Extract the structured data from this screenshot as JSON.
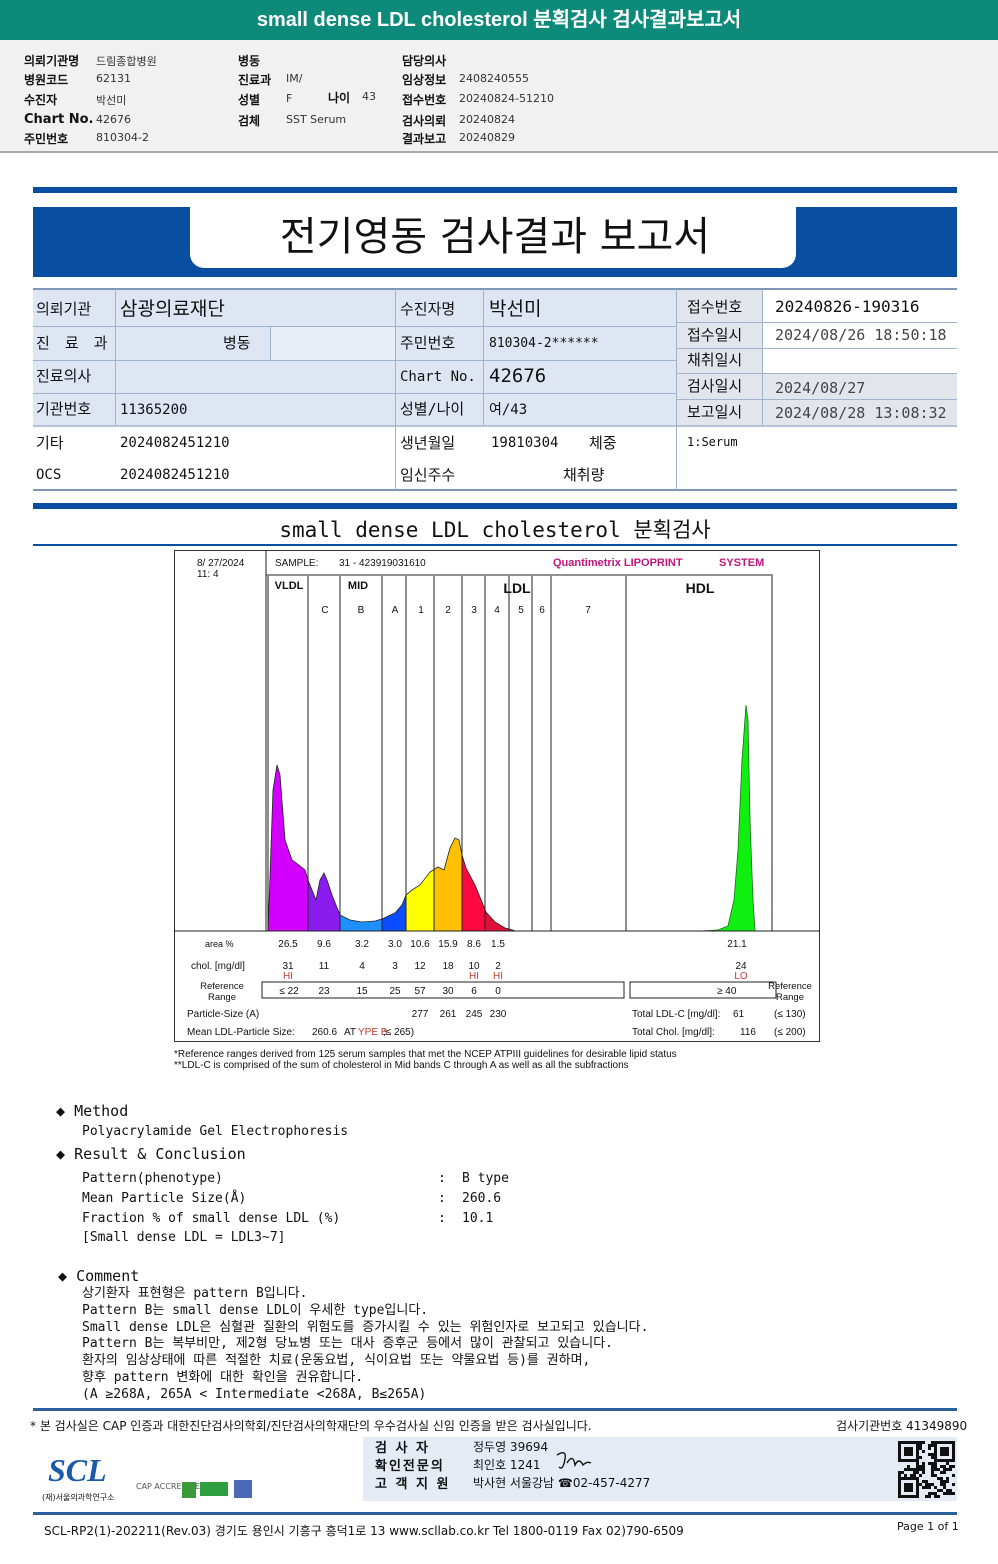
{
  "header": {
    "title": "small dense LDL cholesterol 분획검사 검사결과보고서"
  },
  "info": {
    "col1": [
      {
        "label": "의뢰기관명",
        "value": "드림종합병원"
      },
      {
        "label": "병원코드",
        "value": "62131"
      },
      {
        "label": "수진자",
        "value": "박선미"
      },
      {
        "label": "Chart No.",
        "value": "42676"
      },
      {
        "label": "주민번호",
        "value": "810304-2"
      }
    ],
    "col2": [
      {
        "label": "병동",
        "value": ""
      },
      {
        "label": "진료과",
        "value": "IM/"
      },
      {
        "label": "성별",
        "value": "F"
      },
      {
        "label": "검체",
        "value": "SST Serum"
      }
    ],
    "age_label": "나이",
    "age_value": "43",
    "col3": [
      {
        "label": "담당의사",
        "value": ""
      },
      {
        "label": "임상정보",
        "value": "2408240555"
      },
      {
        "label": "접수번호",
        "value": "20240824-51210"
      },
      {
        "label": "검사의뢰",
        "value": "20240824"
      },
      {
        "label": "결과보고",
        "value": "20240829"
      }
    ]
  },
  "report": {
    "title": "전기영동 검사결과 보고서",
    "rows": {
      "institution_label": "의뢰기관",
      "institution": "삼광의료재단",
      "dept_label": "진 료 과",
      "ward_label": "병동",
      "doctor_label": "진료의사",
      "inst_no_label": "기관번호",
      "inst_no": "11365200",
      "etc_label": "기타",
      "etc": "2024082451210",
      "ocs_label": "OCS",
      "ocs": "2024082451210",
      "patient_label": "수진자명",
      "patient": "박선미",
      "rrn_label": "주민번호",
      "rrn": "810304-2******",
      "chart_label": "Chart No.",
      "chart": "42676",
      "sexage_label": "성별/나이",
      "sexage": "여/43",
      "dob_label": "생년월일",
      "dob": "19810304",
      "weight_label": "체중",
      "preg_label": "임신주수",
      "volume_label": "채취량",
      "receipt_no_label": "접수번호",
      "receipt_no": "20240826-190316",
      "receipt_dt_label": "접수일시",
      "receipt_dt": "2024/08/26 18:50:18",
      "collect_label": "채취일시",
      "collect": "",
      "test_dt_label": "검사일시",
      "test_dt": "2024/08/27",
      "report_dt_label": "보고일시",
      "report_dt": "2024/08/28 13:08:32",
      "specimen": "1:Serum"
    }
  },
  "section_title": "small dense LDL cholesterol 분획검사",
  "chart_data": {
    "type": "area",
    "date": "8/ 27/2024",
    "time": "11:  4",
    "sample_label": "SAMPLE:",
    "sample": "31 - 423919031610",
    "brand": "Quantimetrix LIPOPRINT",
    "brand_suffix": "SYSTEM",
    "groups": [
      "VLDL",
      "MID",
      "LDL",
      "HDL"
    ],
    "bands": [
      "C",
      "B",
      "A",
      "1",
      "2",
      "3",
      "4",
      "5",
      "6",
      "7"
    ],
    "row_labels": {
      "area": "area %",
      "chol": "chol. [mg/dl]",
      "ref": "Reference Range",
      "ref_right": "Reference Range",
      "particle": "Particle-Size (A)",
      "mean": "Mean LDL-Particle Size:"
    },
    "fractions": [
      "VLDL",
      "MID C",
      "MID B",
      "MID A",
      "LDL 1",
      "LDL 2",
      "LDL 3",
      "LDL 4"
    ],
    "area_pct": [
      "26.5",
      "9.6",
      "3.2",
      "3.0",
      "10.6",
      "15.9",
      "8.6",
      "1.5"
    ],
    "chol": [
      "31",
      "11",
      "4",
      "3",
      "12",
      "18",
      "10",
      "2"
    ],
    "flags": [
      "HI",
      "",
      "",
      "",
      "",
      "",
      "HI",
      "HI"
    ],
    "ref": [
      "≤ 22",
      "23",
      "15",
      "25",
      "57",
      "30",
      "6",
      "0"
    ],
    "particle_size": [
      "",
      "",
      "",
      "",
      "277",
      "261",
      "245",
      "230"
    ],
    "hdl": {
      "area_pct": "21.1",
      "chol": "24",
      "flag": "LO",
      "ref": "≥  40"
    },
    "mean_size": "260.6",
    "mean_type_prefix": "AT",
    "mean_type": "YPE B",
    "mean_type_suffix": ";≤ 265)",
    "total_ldl_label": "Total LDL-C [mg/dl]:",
    "total_ldl": "61",
    "total_ldl_ref": "(≤ 130)",
    "total_chol_label": "Total Chol. [mg/dl]:",
    "total_chol": "116",
    "total_chol_ref": "(≤ 200)",
    "colors": {
      "VLDL": "#d400ff",
      "MID C": "#8a1cf0",
      "MID B": "#1e8fff",
      "MID A": "#0a4cff",
      "LDL 1": "#ffff00",
      "LDL 2": "#ffc000",
      "LDL 3": "#ff0840",
      "LDL 4": "#e0103a",
      "HDL": "#10f010"
    }
  },
  "notes": [
    "*Reference ranges derived from 125 serum samples that met the NCEP ATPIII guidelines for desirable lipid status",
    "**LDL-C is comprised of the sum of cholesterol in Mid bands C through A as well as all the subfractions"
  ],
  "method": {
    "title": "Method",
    "text": "Polyacrylamide Gel Electrophoresis"
  },
  "result": {
    "title": "Result & Conclusion",
    "items": [
      {
        "label": "Pattern(phenotype)",
        "value": "B type"
      },
      {
        "label": "Mean Particle Size(Å)",
        "value": "260.6"
      },
      {
        "label": "Fraction % of small dense LDL (%)",
        "value": "10.1"
      }
    ],
    "note": "[Small dense LDL = LDL3~7]"
  },
  "comment": {
    "title": "Comment",
    "lines": [
      "상기환자 표현형은 pattern B입니다.",
      "Pattern B는 small dense LDL이 우세한 type입니다.",
      "Small dense LDL은 심혈관 질환의 위험도를 증가시킬 수 있는 위험인자로 보고되고 있습니다.",
      "Pattern B는 복부비만, 제2형 당뇨병 또는 대사 증후군 등에서 많이 관찰되고 있습니다.",
      "환자의 임상상태에 따른 적절한 치료(운동요법, 식이요법 또는 약물요법 등)를 권하며,",
      "향후 pattern 변화에 대한 확인을 권유합니다.",
      "(A ≥268A, 265A < Intermediate <268A, B≤265A)"
    ]
  },
  "footer": {
    "cert": "* 본 검사실은 CAP 인증과 대한진단검사의학회/진단검사의학재단의 우수검사실 신임 인증을 받은 검사실입니다.",
    "lab_no": "검사기관번호  41349890",
    "tester_label": "검  사  자",
    "tester": "정두영 39694",
    "confirm_label": "확인전문의",
    "confirm": "최인호 1241",
    "support_label": "고 객 지 원",
    "support": "박사현 서울강남 ☎02-457-4277",
    "logo": "SCL",
    "logo_sub": "(재)서울의과학연구소",
    "cap": "CAP ACCREDITED",
    "address": "SCL-RP2(1)-202211(Rev.03)  경기도 용인시 기흥구 흥덕1로 13  www.scllab.co.kr   Tel 1800-0119    Fax 02)790-6509",
    "page": "Page 1 of 1"
  }
}
